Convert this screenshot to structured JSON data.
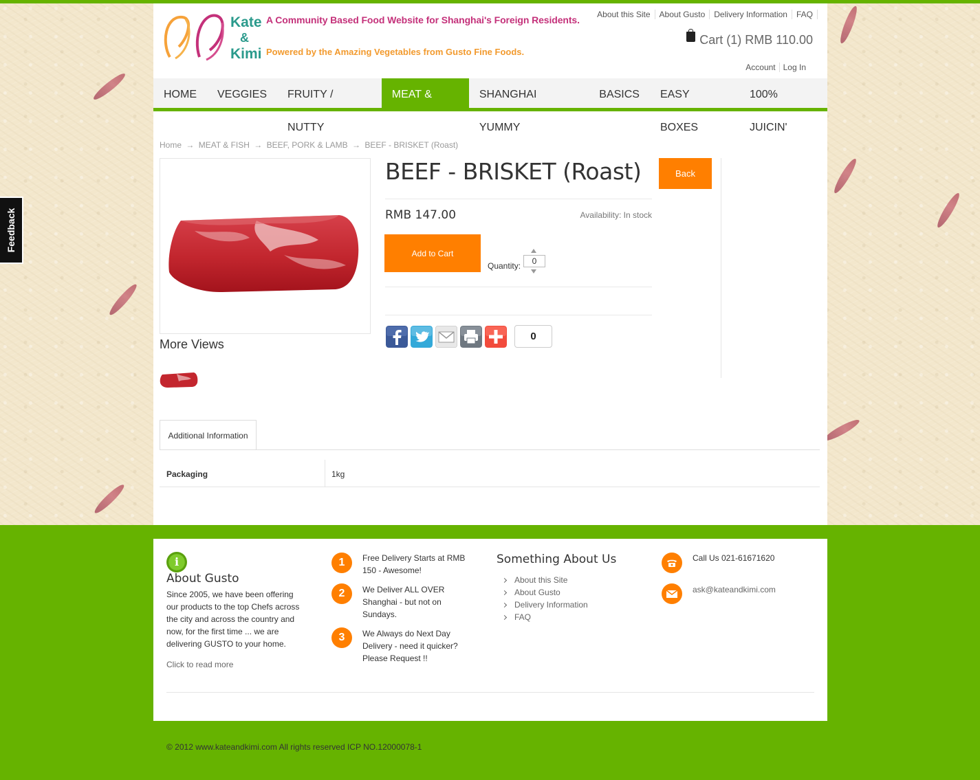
{
  "brand": {
    "logo_line1": "Kate",
    "logo_line2": "&",
    "logo_line3": "Kimi",
    "tagline": "A Community Based Food Website for Shanghai's Foreign Residents.",
    "subtagline": "Powered by the Amazing Vegetables from Gusto Fine Foods."
  },
  "top_links": [
    "About this Site",
    "About Gusto",
    "Delivery Information",
    "FAQ"
  ],
  "cart": {
    "label": "Cart (1) RMB 110.00"
  },
  "account_links": [
    "Account",
    "Log In"
  ],
  "nav": {
    "items": [
      "HOME",
      "VEGGIES",
      "FRUITY / NUTTY",
      "MEAT & FISH",
      "SHANGHAI YUMMY",
      "BASICS",
      "EASY BOXES",
      "100% JUICIN'"
    ],
    "active": "MEAT & FISH"
  },
  "feedback_label": "Feedback",
  "breadcrumb": {
    "items": [
      "Home",
      "MEAT & FISH",
      "BEEF, PORK & LAMB",
      "BEEF - BRISKET (Roast)"
    ],
    "sep": "→"
  },
  "product": {
    "title": "BEEF - BRISKET (Roast)",
    "price": "RMB 147.00",
    "availability": "Availability: In stock",
    "add_to_cart": "Add to Cart",
    "back": "Back",
    "quantity_label": "Quantity:",
    "quantity": "0",
    "more_views": "More Views",
    "share_count": "0"
  },
  "share_icons": [
    "facebook-icon",
    "twitter-icon",
    "email-icon",
    "print-icon",
    "addthis-icon"
  ],
  "tabs": [
    "Additional Information"
  ],
  "attributes": [
    {
      "key": "Packaging",
      "value": "1kg"
    }
  ],
  "footer": {
    "about_title": "About Gusto",
    "about_text": "Since 2005, we have been offering our products to the top Chefs across the city and across the country and now, for the first time ... we are delivering GUSTO to your home.",
    "read_more": "Click to read more",
    "points": [
      {
        "num": "1",
        "text": "Free Delivery Starts at RMB 150 - Awesome!"
      },
      {
        "num": "2",
        "text": "We Deliver ALL OVER Shanghai - but not on Sundays."
      },
      {
        "num": "3",
        "text": "We Always do Next Day Delivery - need it quicker? Please Request !!"
      }
    ],
    "something_title": "Something About Us",
    "something_links": [
      "About this Site",
      "About Gusto",
      "Delivery Information",
      "FAQ"
    ],
    "phone": "Call Us 021-61671620",
    "email": "ask@kateandkimi.com",
    "copyright": "© 2012 www.kateandkimi.com All rights reserved ICP NO.12000078-1"
  },
  "colors": {
    "accent_green": "#66b300",
    "orange": "#ff7f00",
    "brand_pink": "#c4317a",
    "brand_orange": "#f29a2e"
  }
}
